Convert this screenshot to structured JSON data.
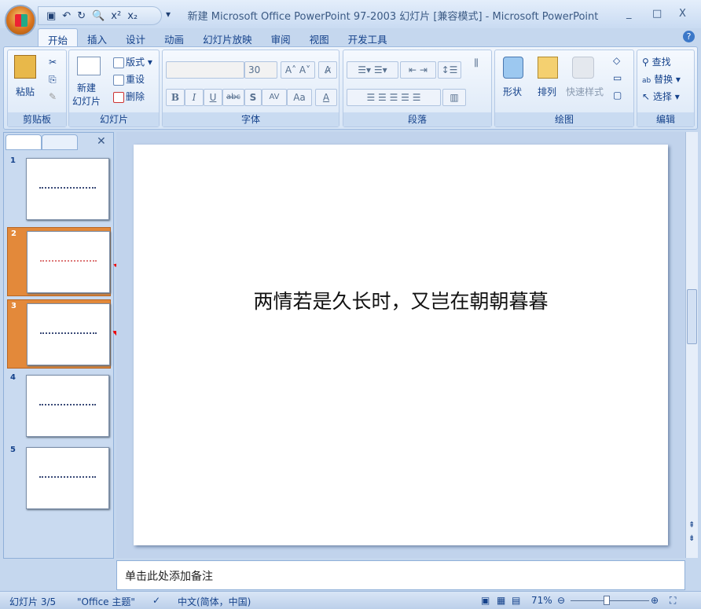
{
  "window": {
    "title": "新建 Microsoft Office PowerPoint 97-2003 幻灯片 [兼容模式] - Microsoft PowerPoint",
    "minimize": "_",
    "maximize": "□",
    "close": "X"
  },
  "qat": {
    "more": "▾"
  },
  "tabs": [
    "开始",
    "插入",
    "设计",
    "动画",
    "幻灯片放映",
    "审阅",
    "视图",
    "开发工具"
  ],
  "help": "?",
  "ribbon": {
    "clipboard": {
      "label": "剪贴板",
      "paste": "粘贴"
    },
    "slides": {
      "label": "幻灯片",
      "new_slide": "新建\n幻灯片",
      "layout": "版式",
      "reset": "重设",
      "delete": "删除"
    },
    "font": {
      "label": "字体",
      "font_name": "",
      "font_size": "30",
      "bold": "B",
      "italic": "I",
      "underline": "U",
      "strike": "abc",
      "shadow": "S",
      "spacing": "AV",
      "case": "Aa",
      "color": "A"
    },
    "paragraph": {
      "label": "段落"
    },
    "drawing": {
      "label": "绘图",
      "shapes": "形状",
      "arrange": "排列",
      "quick_styles": "快速样式"
    },
    "editing": {
      "label": "编辑",
      "find": "查找",
      "replace": "替换",
      "select": "选择"
    }
  },
  "slides_panel": {
    "close": "✕",
    "thumbnails": [
      {
        "number": "1",
        "selected": false
      },
      {
        "number": "2",
        "selected": true
      },
      {
        "number": "3",
        "selected": true
      },
      {
        "number": "4",
        "selected": false
      },
      {
        "number": "5",
        "selected": false
      }
    ]
  },
  "slide": {
    "text": "两情若是久长时，又岂在朝朝暮暮"
  },
  "notes": {
    "placeholder": "单击此处添加备注"
  },
  "status": {
    "slide": "幻灯片 3/5",
    "theme": "\"Office 主题\"",
    "language": "中文(简体，中国)",
    "zoom": "71%",
    "zoom_fraction": 0.42
  }
}
